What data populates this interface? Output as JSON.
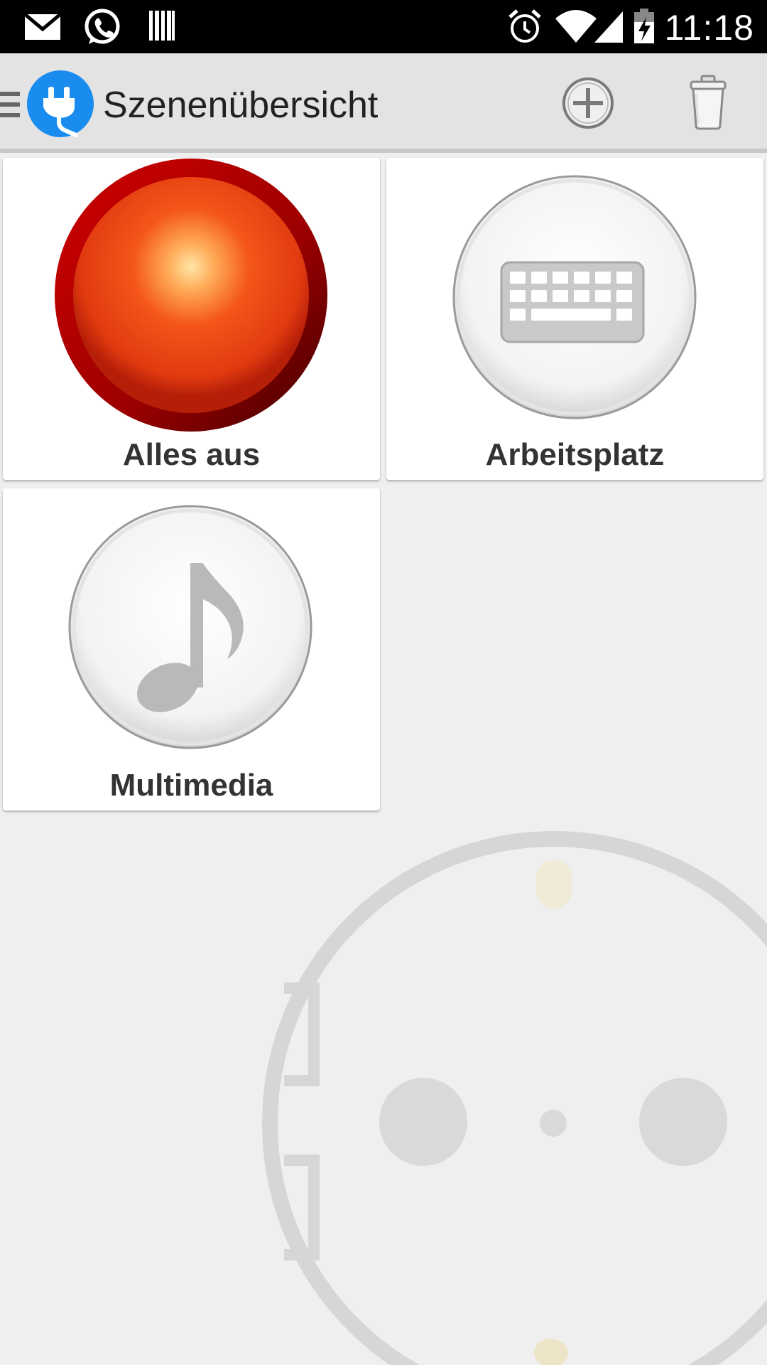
{
  "status_bar": {
    "icons": [
      "mail-icon",
      "whatsapp-icon",
      "barcode-icon",
      "alarm-icon",
      "wifi-icon",
      "signal-icon",
      "battery-charging-icon"
    ],
    "time": "11:18"
  },
  "action_bar": {
    "title": "Szenenübersicht",
    "app_icon": "plug-icon",
    "actions": [
      "add-icon",
      "trash-icon"
    ]
  },
  "scenes": [
    {
      "label": "Alles aus",
      "icon": "red-power-button-icon"
    },
    {
      "label": "Arbeitsplatz",
      "icon": "keyboard-icon"
    },
    {
      "label": "Multimedia",
      "icon": "music-note-icon"
    }
  ],
  "colors": {
    "status_bar_bg": "#000000",
    "action_bar_bg": "#e3e3e3",
    "app_icon_blue": "#1a8cf0",
    "alles_aus_red": "#e8320e",
    "tile_bg": "#ffffff",
    "page_bg": "#efefef"
  }
}
